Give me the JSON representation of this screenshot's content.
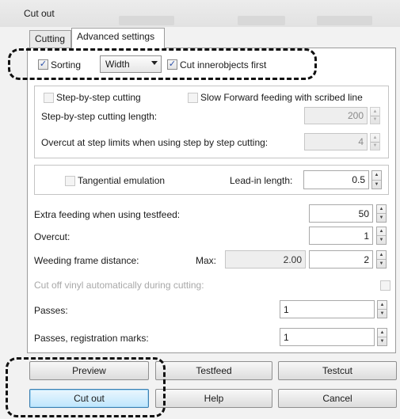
{
  "window": {
    "title": "Cut out"
  },
  "tabs": [
    {
      "label": "Cutting",
      "active": false
    },
    {
      "label": "Advanced settings",
      "active": true
    }
  ],
  "sorting": {
    "sorting_label": "Sorting",
    "sorting_checked": true,
    "select_value": "Width",
    "innerobjects_label": "Cut innerobjects first",
    "innerobjects_checked": true
  },
  "step_group": {
    "step_by_step_label": "Step-by-step cutting",
    "step_by_step_checked": false,
    "slow_forward_label": "Slow Forward feeding with scribed line",
    "slow_forward_checked": false,
    "length_label": "Step-by-step cutting length:",
    "length_value": "200",
    "overcut_label": "Overcut at step limits when using step by step cutting:",
    "overcut_value": "4"
  },
  "tangential": {
    "label": "Tangential emulation",
    "checked": false,
    "leadin_label": "Lead-in length:",
    "leadin_value": "0.5"
  },
  "fields": {
    "extra_feeding_label": "Extra feeding when using testfeed:",
    "extra_feeding_value": "50",
    "overcut_label": "Overcut:",
    "overcut_value": "1",
    "weeding_label": "Weeding frame distance:",
    "weeding_max_label": "Max:",
    "weeding_max_value": "2.00",
    "weeding_value": "2",
    "cut_off_vinyl_label": "Cut off vinyl automatically during cutting:",
    "passes_label": "Passes:",
    "passes_value": "1",
    "passes_reg_label": "Passes, registration marks:",
    "passes_reg_value": "1"
  },
  "buttons": {
    "preview": "Preview",
    "testfeed": "Testfeed",
    "testcut": "Testcut",
    "cut_out": "Cut out",
    "help": "Help",
    "cancel": "Cancel"
  },
  "icons": {
    "check": "✓",
    "spin_up": "▲",
    "spin_down": "▼"
  }
}
